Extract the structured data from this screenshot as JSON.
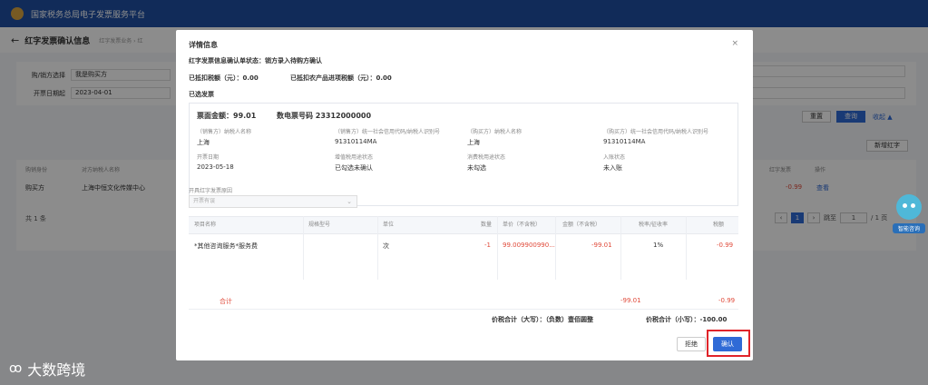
{
  "topbar": {
    "title": "国家税务总局电子发票服务平台"
  },
  "page": {
    "title": "红字发票确认信息",
    "breadcrumb": "红字发票业务 › 红",
    "filters": {
      "row1_label": "购/销方选择",
      "row1_value": "我是购买方",
      "row2_label": "开票日期起",
      "row2_value": "2023-04-01",
      "right1": "请选择",
      "right2": "请选择"
    },
    "buttons": {
      "reset": "重置",
      "search": "查询",
      "collapse": "收起 ▲",
      "new": "新增红字"
    },
    "table": {
      "headers": [
        "购销身份",
        "对方纳税人名称",
        "红字发票",
        "操作"
      ],
      "row": {
        "role": "购买方",
        "name": "上海中恒文化传媒中心",
        "amount": "-0.99",
        "action": "查看"
      }
    },
    "pager": {
      "total": "共 1 条",
      "current": "1",
      "goto": "跳至",
      "page_input": "1",
      "suffix": "/ 1 页"
    }
  },
  "modal": {
    "title": "详情信息",
    "status": "红字发票信息确认单状态：销方录入待购方确认",
    "deduction": "已抵扣税额（元）：0.00",
    "agri_deduction": "已抵扣农产品进项税额（元）：0.00",
    "section": "已选发票",
    "card": {
      "amount": "票面金额：99.01",
      "invoice_no": "数电票号码 23312000000",
      "seller_name_label": "（销售方）纳税人名称",
      "seller_name_value": "上海",
      "seller_code_label": "（销售方）统一社会信用代码/纳税人识别号",
      "seller_code_value": "91310114MA",
      "buyer_name_label": "（购买方）纳税人名称",
      "buyer_name_value": "上海",
      "buyer_code_label": "（购买方）统一社会信用代码/纳税人识别号",
      "buyer_code_value": "91310114MA",
      "date_label": "开票日期",
      "date_value": "2023-05-18",
      "vat_label": "增值税用途状态",
      "vat_value": "已勾选未确认",
      "consumption_label": "消费税用途状态",
      "consumption_value": "未勾选",
      "entry_label": "入账状态",
      "entry_value": "未入账"
    },
    "reason_label": "开具红字发票原因",
    "reason_value": "开票有误",
    "lines": {
      "headers": [
        "项目名称",
        "规格型号",
        "单位",
        "数量",
        "单价（不含税）",
        "金额（不含税）",
        "税率/征收率",
        "税额"
      ],
      "row": {
        "item": "*其他咨询服务*服务费",
        "unit": "次",
        "qty": "-1",
        "price": "99.009900990...",
        "amount": "-99.01",
        "rate": "1%",
        "tax": "-0.99"
      },
      "total_label": "合计",
      "total_amount": "-99.01",
      "total_tax": "-0.99",
      "sum_words": "价税合计（大写）：（负数）壹佰圆整",
      "sum_number": "价税合计（小写）：-100.00"
    },
    "buttons": {
      "reject": "拒绝",
      "confirm": "确认"
    }
  },
  "assistant": {
    "label": "智能咨询"
  },
  "watermark": {
    "text": "大数跨境"
  },
  "colors": {
    "primary": "#2f6ad6",
    "topbar": "#1f4fa3",
    "danger": "#e04a3a",
    "highlight": "#e0242a"
  }
}
